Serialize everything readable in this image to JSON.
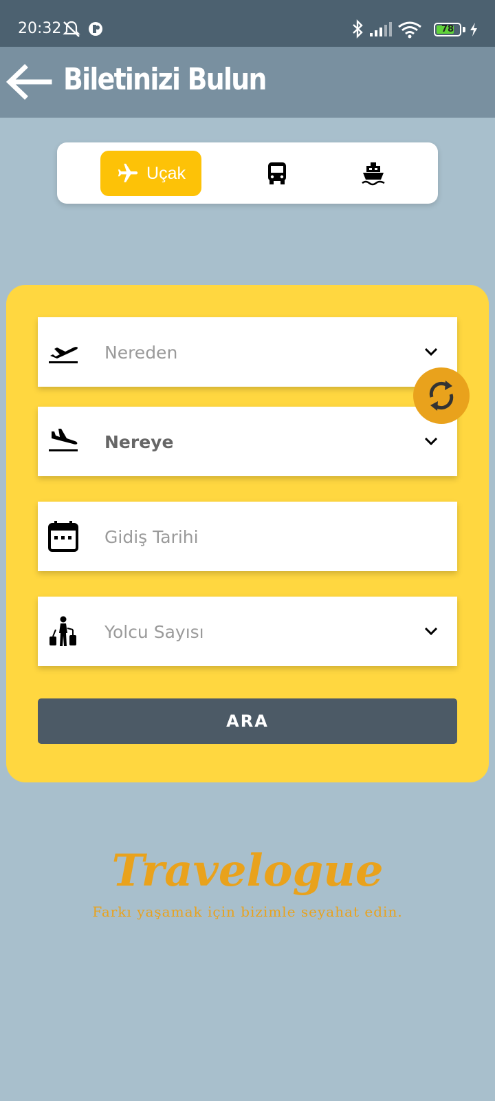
{
  "status_bar": {
    "time": "20:32",
    "battery": "78",
    "battery_level": 0.78,
    "icons": [
      "dnd-off-icon",
      "app-notification-icon",
      "bluetooth-icon",
      "signal-icon",
      "wifi-icon",
      "battery-icon",
      "charging-icon"
    ]
  },
  "app_bar": {
    "title": "Biletinizi Bulun",
    "back_icon": "arrow-left-icon"
  },
  "mode_tabs": {
    "items": [
      {
        "label": "Uçak",
        "icon": "plane-icon",
        "selected": true
      },
      {
        "label": "",
        "icon": "bus-icon",
        "selected": false
      },
      {
        "label": "",
        "icon": "ship-icon",
        "selected": false
      }
    ],
    "selected_color": "#fdc207"
  },
  "form": {
    "from": {
      "label": "Nereden",
      "icon": "takeoff-icon"
    },
    "to": {
      "label": "Nereye",
      "icon": "landing-icon"
    },
    "date": {
      "label": "Gidiş Tarihi",
      "icon": "calendar-icon"
    },
    "passengers": {
      "label": "Yolcu Sayısı",
      "icon": "traveler-luggage-icon"
    },
    "swap_icon": "swap-refresh-icon",
    "search_label": "ARA",
    "card_color": "#ffd740",
    "accent_color": "#e9a21c"
  },
  "brand": {
    "name": "Travelogue",
    "slogan": "Farkı yaşamak için bizimle seyahat edin."
  }
}
